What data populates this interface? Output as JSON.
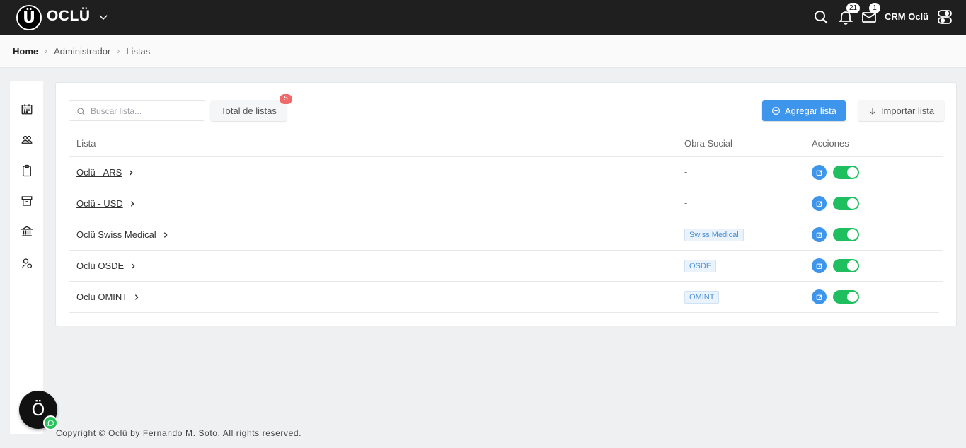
{
  "topbar": {
    "logo_letter": "Ü",
    "brand": "OCLÜ",
    "notifications_count": "21",
    "messages_count": "1",
    "user_name": "CRM Oclü",
    "icons": [
      "chevron-down-icon",
      "search-icon",
      "bell-icon",
      "mail-icon",
      "toggle-settings-icon"
    ]
  },
  "breadcrumb": {
    "home": "Home",
    "items": [
      "Administrador",
      "Listas"
    ]
  },
  "sidebar": {
    "icons": [
      "calendar-icon",
      "users-icon",
      "clipboard-icon",
      "archive-icon",
      "bank-icon",
      "user-group-icon"
    ]
  },
  "toolbar": {
    "search_placeholder": "Buscar lista...",
    "total_label": "Total de listas",
    "total_count": "5",
    "add_label": "Agregar lista",
    "import_label": "Importar lista"
  },
  "table": {
    "headers": {
      "lista": "Lista",
      "obra_social": "Obra Social",
      "acciones": "Acciones"
    },
    "rows": [
      {
        "name": "Oclü - ARS",
        "obra_social": "-",
        "active": true
      },
      {
        "name": "Oclü - USD",
        "obra_social": "-",
        "active": true
      },
      {
        "name": "Oclü Swiss Medical",
        "obra_social": "Swiss Medical",
        "active": true
      },
      {
        "name": "Oclü OSDE",
        "obra_social": "OSDE",
        "active": true
      },
      {
        "name": "Oclü OMINT",
        "obra_social": "OMINT",
        "active": true
      }
    ]
  },
  "footer": {
    "text": "Copyright © Oclü by Fernando M. Soto, All rights reserved."
  },
  "chat": {
    "letter": "Ö"
  },
  "colors": {
    "topbar": "#1f1f1f",
    "accent": "#3d95ec",
    "toggle_on": "#1fbf5f",
    "badge": "#f06a6a"
  }
}
